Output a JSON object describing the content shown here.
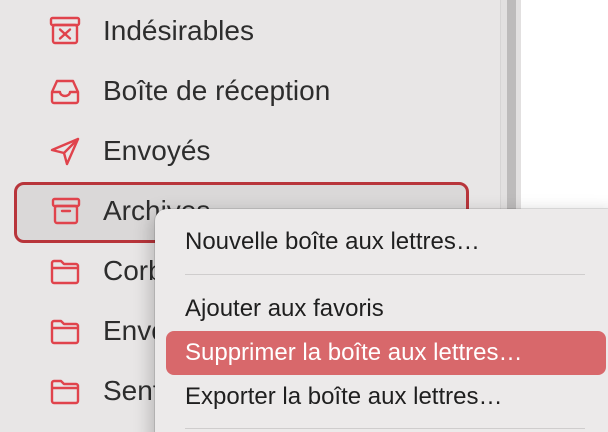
{
  "sidebar": {
    "items": [
      {
        "label": "Indésirables",
        "icon": "junk-tray-icon"
      },
      {
        "label": "Boîte de réception",
        "icon": "inbox-tray-icon"
      },
      {
        "label": "Envoyés",
        "icon": "paper-plane-icon"
      },
      {
        "label": "Archives",
        "icon": "archive-box-icon",
        "targeted": true
      },
      {
        "label": "Corb",
        "icon": "folder-icon"
      },
      {
        "label": "Envo",
        "icon": "folder-icon"
      },
      {
        "label": "Sent",
        "icon": "folder-icon"
      }
    ]
  },
  "context_menu": {
    "items": [
      {
        "label": "Nouvelle boîte aux lettres…"
      },
      {
        "label": "Ajouter aux favoris"
      },
      {
        "label": "Supprimer la boîte aux lettres…",
        "highlighted": true
      },
      {
        "label": "Exporter la boîte aux lettres…"
      }
    ]
  },
  "colors": {
    "accent_icon": "#e0434c",
    "focus_ring": "#b8353b",
    "menu_highlight": "#d8686b",
    "sidebar_bg": "#e8e6e6",
    "menu_bg": "#eceaea"
  }
}
